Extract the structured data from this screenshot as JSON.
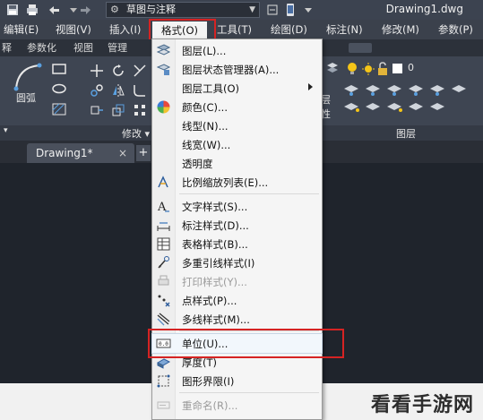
{
  "titlebar": {
    "workspace": "草图与注释",
    "document_title": "Drawing1.dwg"
  },
  "menubar": {
    "items": [
      "编辑(E)",
      "视图(V)",
      "插入(I)",
      "格式(O)",
      "工具(T)",
      "绘图(D)",
      "标注(N)",
      "修改(M)",
      "参数(P)"
    ]
  },
  "ribbon_tabs": [
    "释",
    "参数化",
    "视图",
    "管理"
  ],
  "ribbon": {
    "circle_label": "圆弧",
    "modify_label": "修改 ▾",
    "layer_label": "图层",
    "layer_value": "0",
    "layer_props": [
      "层",
      "性"
    ]
  },
  "doc_tab": {
    "name": "Drawing1*",
    "close": "×",
    "add": "+"
  },
  "format_menu": {
    "items": [
      {
        "label": "图层(L)...",
        "icon": "layer-icon"
      },
      {
        "label": "图层状态管理器(A)...",
        "icon": "layer-state-icon"
      },
      {
        "label": "图层工具(O)",
        "icon": "",
        "submenu": true
      },
      {
        "label": "颜色(C)...",
        "icon": "color-wheel-icon"
      },
      {
        "label": "线型(N)...",
        "icon": ""
      },
      {
        "label": "线宽(W)...",
        "icon": ""
      },
      {
        "label": "透明度",
        "icon": ""
      },
      {
        "label": "比例缩放列表(E)...",
        "icon": "scale-list-icon"
      },
      {
        "label": "文字样式(S)...",
        "icon": "text-style-icon"
      },
      {
        "label": "标注样式(D)...",
        "icon": "dim-style-icon"
      },
      {
        "label": "表格样式(B)...",
        "icon": "table-style-icon"
      },
      {
        "label": "多重引线样式(I)",
        "icon": "mleader-style-icon"
      },
      {
        "label": "打印样式(Y)...",
        "icon": "plot-style-icon",
        "disabled": true
      },
      {
        "label": "点样式(P)...",
        "icon": "point-style-icon"
      },
      {
        "label": "多线样式(M)...",
        "icon": "mline-style-icon"
      },
      {
        "label": "单位(U)...",
        "icon": "units-icon",
        "highlighted": true
      },
      {
        "label": "厚度(T)",
        "icon": "thickness-icon"
      },
      {
        "label": "图形界限(I)",
        "icon": "drawing-limits-icon"
      },
      {
        "label": "重命名(R)...",
        "icon": "rename-icon",
        "disabled": true
      }
    ]
  },
  "watermark": "看看手游网",
  "colors": {
    "highlight_box": "#d52323",
    "menu_bg": "#f5f5f5",
    "ribbon_bg": "#3e4552"
  }
}
